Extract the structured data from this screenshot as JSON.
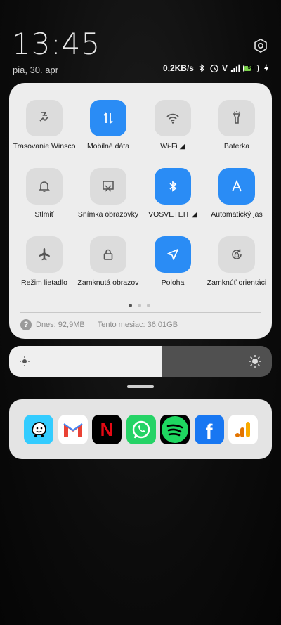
{
  "status": {
    "time": "13:45",
    "date": "pia, 30. apr",
    "speed": "0,2KB/s",
    "carrier_mark": "V",
    "battery": "53",
    "battery_level": 0.53
  },
  "tiles": [
    {
      "label": "Trasovanie Winsco",
      "icon": "trace-icon",
      "active": false
    },
    {
      "label": "Mobilné dáta",
      "icon": "mobile-data-icon",
      "active": true
    },
    {
      "label": "Wi-Fi ◢",
      "icon": "wifi-icon",
      "active": false
    },
    {
      "label": "Baterka",
      "icon": "flashlight-icon",
      "active": false
    },
    {
      "label": "Stlmiť",
      "icon": "bell-icon",
      "active": false
    },
    {
      "label": "Snímka obrazovky",
      "icon": "screenshot-icon",
      "active": false
    },
    {
      "label": "VOSVETEIT ◢",
      "icon": "bluetooth-icon",
      "active": true
    },
    {
      "label": "Automatický jas",
      "icon": "auto-brightness-icon",
      "active": true
    },
    {
      "label": "Režim lietadlo",
      "icon": "airplane-icon",
      "active": false
    },
    {
      "label": "Zamknutá obrazov",
      "icon": "lock-icon",
      "active": false
    },
    {
      "label": "Poloha",
      "icon": "location-icon",
      "active": true
    },
    {
      "label": "Zamknúť orientáci",
      "icon": "rotation-lock-icon",
      "active": false
    }
  ],
  "usage": {
    "today": "Dnes: 92,9MB",
    "month": "Tento mesiac: 36,01GB"
  },
  "brightness": {
    "level": 0.58
  },
  "dock_apps": [
    {
      "name": "waze-app-icon",
      "bg": "#33ccff",
      "glyph": "☺"
    },
    {
      "name": "gmail-app-icon",
      "bg": "#ffffff",
      "glyph": "M"
    },
    {
      "name": "netflix-app-icon",
      "bg": "#000000",
      "glyph": "N"
    },
    {
      "name": "whatsapp-app-icon",
      "bg": "#25d366",
      "glyph": "☎"
    },
    {
      "name": "spotify-app-icon",
      "bg": "#000000",
      "glyph": "≋"
    },
    {
      "name": "facebook-app-icon",
      "bg": "#1877f2",
      "glyph": "f"
    },
    {
      "name": "analytics-app-icon",
      "bg": "#ffffff",
      "glyph": "▎"
    }
  ],
  "colors": {
    "accent": "#2a8cf5",
    "panel": "#ededed"
  }
}
